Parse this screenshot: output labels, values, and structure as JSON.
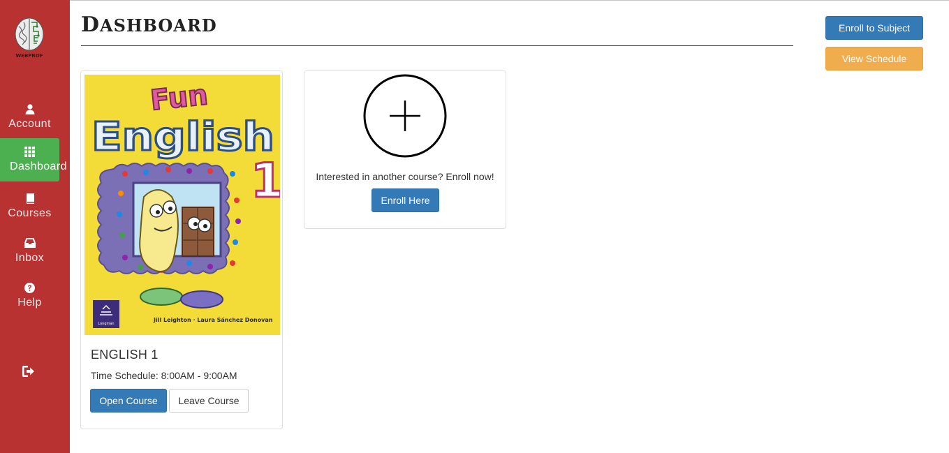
{
  "sidebar": {
    "logo_text": "WEBPROF",
    "items": [
      {
        "label": "Account",
        "icon": "user-icon"
      },
      {
        "label": "Dashboard",
        "icon": "grid-icon",
        "active": true
      },
      {
        "label": "Courses",
        "icon": "book-icon"
      },
      {
        "label": "Inbox",
        "icon": "inbox-icon"
      },
      {
        "label": "Help",
        "icon": "question-circle-icon"
      }
    ],
    "logout_icon": "logout-icon"
  },
  "header": {
    "title_first": "D",
    "title_rest": "ASHBOARD"
  },
  "actions": {
    "enroll_subject": "Enroll to Subject",
    "view_schedule": "View Schedule"
  },
  "course": {
    "cover": {
      "line1": "Fun",
      "line2": "English",
      "number": "1",
      "authors": "Jill Leighton · Laura Sánchez Donovan",
      "publisher": "Longman"
    },
    "title": "ENGLISH 1",
    "schedule": "Time Schedule: 8:00AM - 9:00AM",
    "open_label": "Open Course",
    "leave_label": "Leave Course"
  },
  "enroll": {
    "text": "Interested in another course? Enroll now!",
    "button": "Enroll Here"
  },
  "colors": {
    "sidebar": "#b83232",
    "active": "#4caf50",
    "primary": "#337ab7",
    "warning": "#f0ad4e",
    "cover_bg": "#f3dc37"
  }
}
